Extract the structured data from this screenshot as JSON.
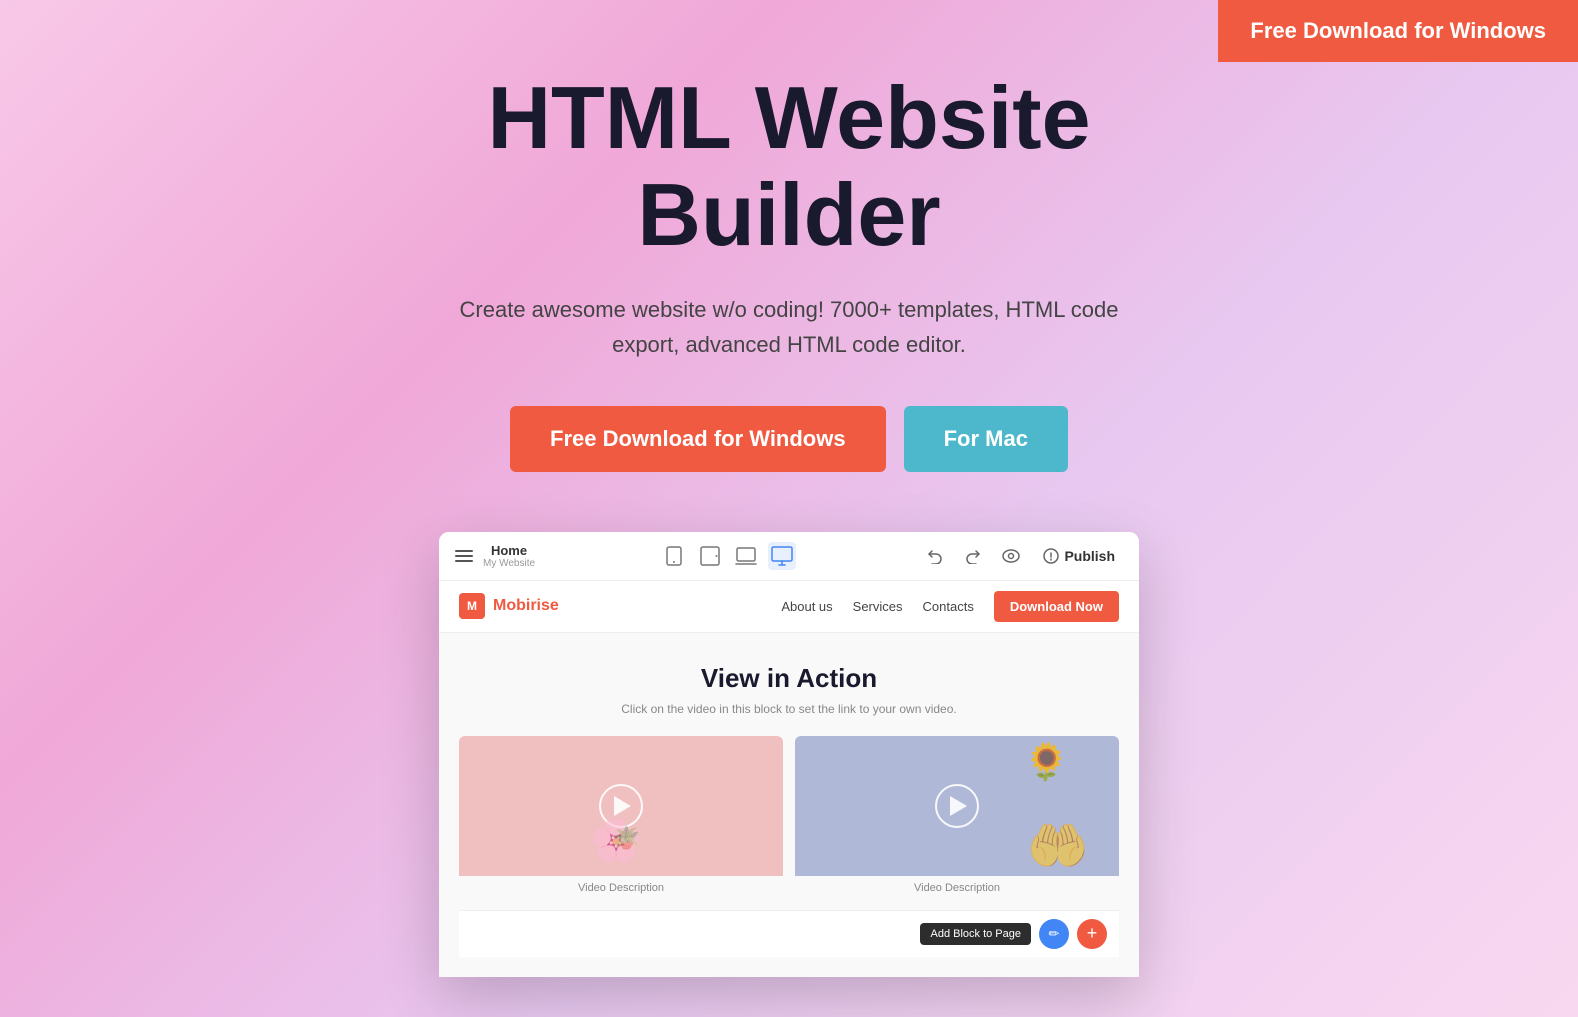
{
  "topCta": {
    "label": "Free Download for Windows"
  },
  "hero": {
    "title": "HTML Website Builder",
    "subtitle": "Create awesome website w/o coding! 7000+ templates, HTML code export, advanced HTML code editor.",
    "btnWindows": "Free Download for Windows",
    "btnMac": "For Mac"
  },
  "appWindow": {
    "toolbar": {
      "pageName": "Home",
      "siteName": "My Website",
      "publishLabel": "Publish"
    },
    "navbar": {
      "logoText": "Mobirise",
      "links": [
        "About us",
        "Services",
        "Contacts"
      ],
      "ctaLabel": "Download Now"
    },
    "content": {
      "title": "View in Action",
      "subtitle": "Click on the video in this block to set the link to your own video.",
      "video1Description": "Video Description",
      "video2Description": "Video Description"
    },
    "bottomBar": {
      "addBlockLabel": "Add Block to Page",
      "editIcon": "✏",
      "addIcon": "+"
    }
  }
}
